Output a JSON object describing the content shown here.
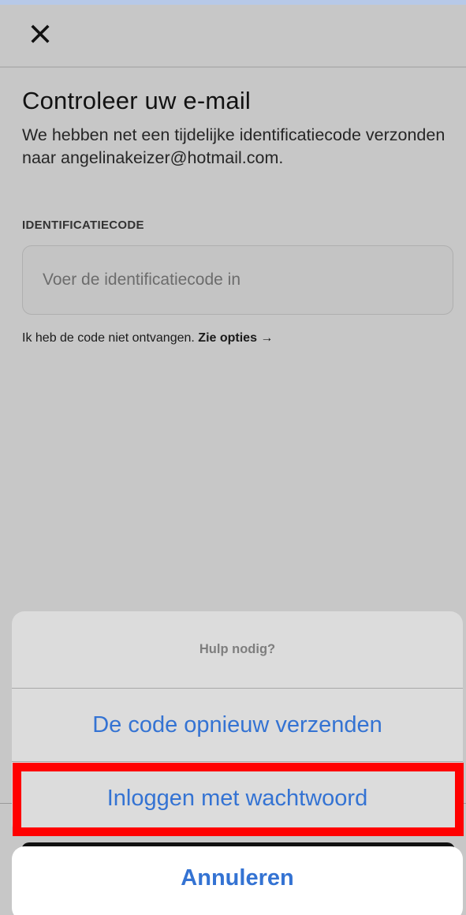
{
  "header": {
    "close_icon": "close-icon"
  },
  "main": {
    "title": "Controleer uw e-mail",
    "description": "We hebben net een tijdelijke identificatiecode verzonden naar angelinakeizer@hotmail.com.",
    "field_label": "IDENTIFICATIECODE",
    "code_input": {
      "value": "",
      "placeholder": "Voer de identificatiecode in"
    },
    "help_text": "Ik heb de code niet ontvangen.",
    "help_link": "Zie opties →"
  },
  "action_sheet": {
    "title": "Hulp nodig?",
    "actions": [
      {
        "label": "De code opnieuw verzenden"
      },
      {
        "label": "Inloggen met wachtwoord"
      }
    ],
    "cancel_label": "Annuleren",
    "accent_color": "#3473d3",
    "highlight_color": "#ff0000"
  }
}
